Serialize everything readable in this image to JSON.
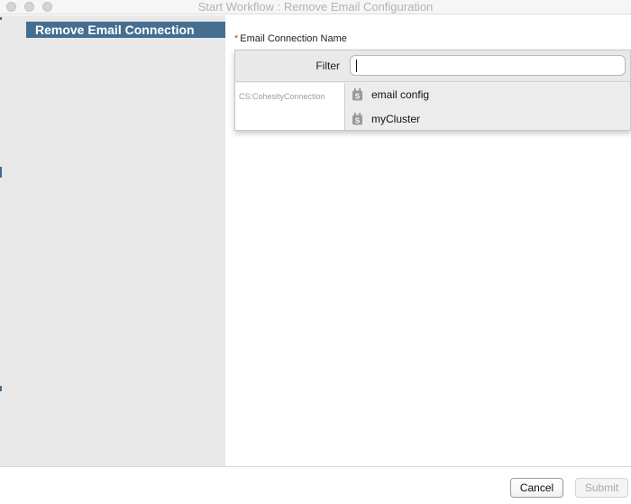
{
  "window": {
    "title": "Start Workflow : Remove Email Configuration"
  },
  "sidebar": {
    "steps": [
      {
        "label": "Remove Email Connection",
        "selected": true
      }
    ]
  },
  "form": {
    "field": {
      "required_mark": "*",
      "label": "Email Connection Name"
    },
    "picker": {
      "filter_label": "Filter",
      "filter_value": "",
      "type_label": "CS:CohesityConnection",
      "items": [
        {
          "label": "email config",
          "icon": "connection-plug-icon"
        },
        {
          "label": "myCluster",
          "icon": "connection-plug-icon"
        }
      ]
    }
  },
  "footer": {
    "cancel_label": "Cancel",
    "submit_label": "Submit",
    "submit_enabled": false
  },
  "colors": {
    "step_selected_bg": "#466e91",
    "required_mark": "#d9363e",
    "sidebar_bg": "#e8e8e8"
  }
}
